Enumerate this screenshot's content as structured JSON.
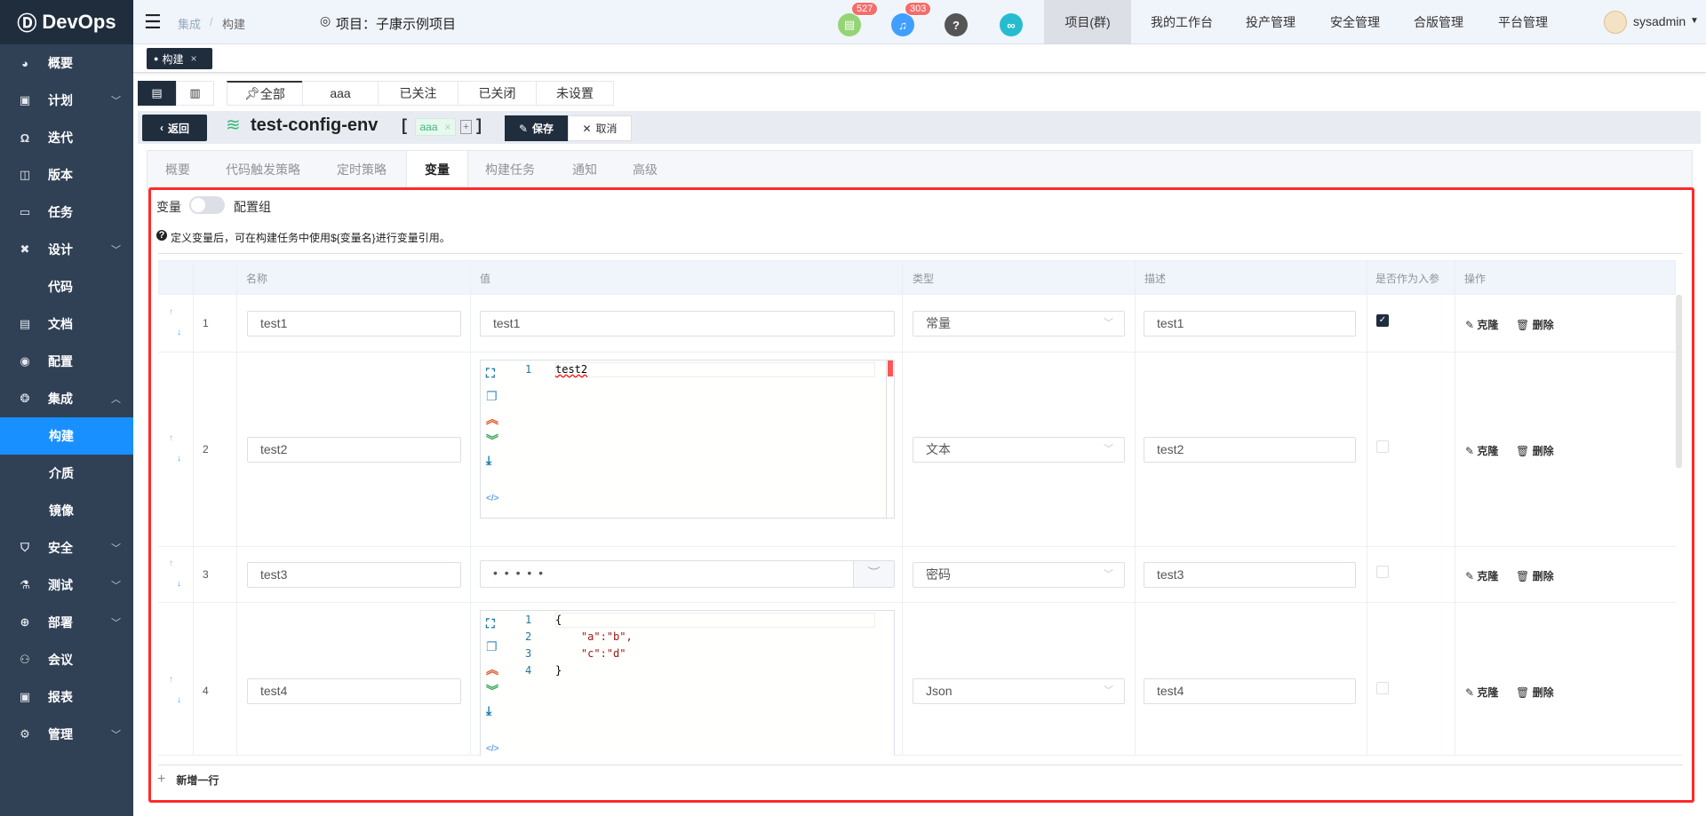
{
  "app": {
    "logo": "DevOps"
  },
  "sidebar": {
    "items": [
      {
        "label": "概要",
        "icon": "dashboard-icon"
      },
      {
        "label": "计划",
        "icon": "plan-icon",
        "chevron": "down"
      },
      {
        "label": "迭代",
        "icon": "iteration-icon"
      },
      {
        "label": "版本",
        "icon": "version-icon"
      },
      {
        "label": "任务",
        "icon": "task-icon"
      },
      {
        "label": "设计",
        "icon": "design-icon",
        "chevron": "down"
      },
      {
        "label": "代码",
        "icon": "code-icon"
      },
      {
        "label": "文档",
        "icon": "doc-icon"
      },
      {
        "label": "配置",
        "icon": "config-icon"
      },
      {
        "label": "集成",
        "icon": "integration-icon",
        "chevron": "up"
      },
      {
        "label": "构建",
        "sub": true,
        "active": true
      },
      {
        "label": "介质",
        "sub": true
      },
      {
        "label": "镜像",
        "sub": true
      },
      {
        "label": "安全",
        "icon": "shield-icon",
        "chevron": "down"
      },
      {
        "label": "测试",
        "icon": "flask-icon",
        "chevron": "down"
      },
      {
        "label": "部署",
        "icon": "crosshair-icon",
        "chevron": "down"
      },
      {
        "label": "会议",
        "icon": "meeting-icon"
      },
      {
        "label": "报表",
        "icon": "report-icon"
      },
      {
        "label": "管理",
        "icon": "gear-icon",
        "chevron": "down"
      }
    ]
  },
  "topbar": {
    "breadcrumb": [
      "集成",
      "构建"
    ],
    "project": "项目：子康示例项目",
    "badges": {
      "docs": "527",
      "bell": "303"
    },
    "nav": [
      "项目(群)",
      "我的工作台",
      "投产管理",
      "安全管理",
      "合版管理",
      "平台管理"
    ],
    "user": "sysadmin"
  },
  "tagstrip": {
    "tag": "构建",
    "close": "×"
  },
  "filter": {
    "tabs": [
      "全部",
      "aaa",
      "已关注",
      "已关闭",
      "未设置"
    ]
  },
  "header": {
    "back": "返回",
    "title": "test-config-env",
    "tag": "aaa",
    "tag_close": "×",
    "add": "+",
    "save": "保存",
    "cancel": "取消",
    "bracket_open": "[",
    "bracket_close": "]"
  },
  "tabs": [
    "概要",
    "代码触发策略",
    "定时策略",
    "变量",
    "构建任务",
    "通知",
    "高级"
  ],
  "vars": {
    "toggle_left": "变量",
    "toggle_right": "配置组",
    "hint": "定义变量后，可在构建任务中使用${变量名}进行变量引用。",
    "add_row": "新增一行",
    "columns": [
      "名称",
      "值",
      "类型",
      "描述",
      "是否作为入参",
      "操作"
    ],
    "clone": "克隆",
    "delete": "删除",
    "rows": [
      {
        "no": "1",
        "name": "test1",
        "value": "test1",
        "type": "常量",
        "desc": "test1",
        "param": true
      },
      {
        "no": "2",
        "name": "test2",
        "value_lines": [
          "test2"
        ],
        "line_nos": [
          "1"
        ],
        "type": "文本",
        "desc": "test2",
        "param": false
      },
      {
        "no": "3",
        "name": "test3",
        "value": "• • • • •",
        "type": "密码",
        "desc": "test3",
        "param": false
      },
      {
        "no": "4",
        "name": "test4",
        "value_lines": [
          "{",
          "    \"a\":\"b\",",
          "    \"c\":\"d\"",
          "}"
        ],
        "line_nos": [
          "1",
          "2",
          "3",
          "4"
        ],
        "type": "Json",
        "desc": "test4",
        "param": false
      }
    ]
  }
}
